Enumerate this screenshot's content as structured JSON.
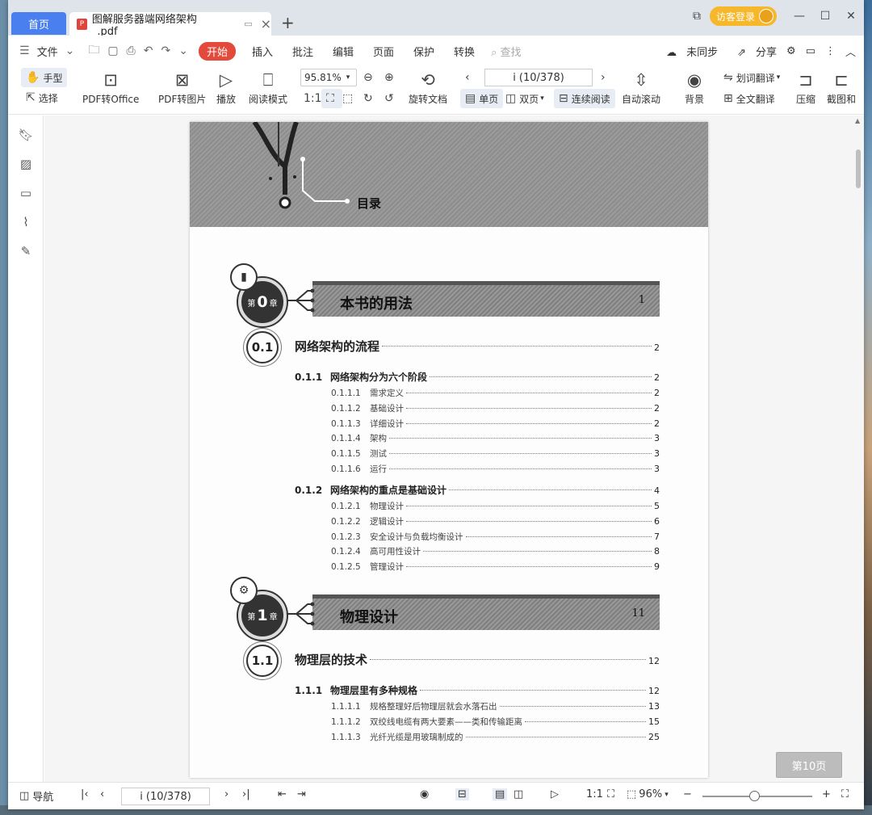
{
  "tabs": {
    "home": "首页",
    "doc_title": "图解服务器端网络架构_.pdf",
    "new_tab": "+"
  },
  "window": {
    "visitor": "访客登录",
    "minimize": "—",
    "maximize": "☐",
    "close": "✕",
    "panel": "⧉"
  },
  "menu": {
    "file": "文件",
    "items": [
      "开始",
      "插入",
      "批注",
      "编辑",
      "页面",
      "保护",
      "转换"
    ],
    "search_placeholder": "查找",
    "unsynced": "未同步",
    "share": "分享"
  },
  "ribbon": {
    "hand": "手型",
    "select": "选择",
    "pdf_to_office": "PDF转Office",
    "pdf_to_image": "PDF转图片",
    "play": "播放",
    "read_mode": "阅读模式",
    "zoom": "95.81%",
    "rotate_doc": "旋转文档",
    "page_indicator": "i (10/378)",
    "single_page": "单页",
    "double_page": "双页",
    "continuous": "连续阅读",
    "auto_scroll": "自动滚动",
    "background": "背景",
    "word_translate": "划词翻译",
    "full_translate": "全文翻译",
    "compress": "压缩",
    "screenshot": "截图和"
  },
  "document": {
    "header_title": "目录",
    "chapters": [
      {
        "label_pre": "第",
        "label_num": "0",
        "label_post": "章",
        "title": "本书的用法",
        "page": "1",
        "sections": [
          {
            "num": "0.1",
            "title": "网络架构的流程",
            "page": "2"
          }
        ],
        "entries": [
          {
            "level": 2,
            "num": "0.1.1",
            "title": "网络架构分为六个阶段",
            "page": "2"
          },
          {
            "level": 3,
            "num": "0.1.1.1",
            "title": "需求定义",
            "page": "2"
          },
          {
            "level": 3,
            "num": "0.1.1.2",
            "title": "基础设计",
            "page": "2"
          },
          {
            "level": 3,
            "num": "0.1.1.3",
            "title": "详细设计",
            "page": "2"
          },
          {
            "level": 3,
            "num": "0.1.1.4",
            "title": "架构",
            "page": "3"
          },
          {
            "level": 3,
            "num": "0.1.1.5",
            "title": "测试",
            "page": "3"
          },
          {
            "level": 3,
            "num": "0.1.1.6",
            "title": "运行",
            "page": "3"
          },
          {
            "level": 2,
            "num": "0.1.2",
            "title": "网络架构的重点是基础设计",
            "page": "4"
          },
          {
            "level": 3,
            "num": "0.1.2.1",
            "title": "物理设计",
            "page": "5"
          },
          {
            "level": 3,
            "num": "0.1.2.2",
            "title": "逻辑设计",
            "page": "6"
          },
          {
            "level": 3,
            "num": "0.1.2.3",
            "title": "安全设计与负载均衡设计",
            "page": "7"
          },
          {
            "level": 3,
            "num": "0.1.2.4",
            "title": "高可用性设计",
            "page": "8"
          },
          {
            "level": 3,
            "num": "0.1.2.5",
            "title": "管理设计",
            "page": "9"
          }
        ]
      },
      {
        "label_pre": "第",
        "label_num": "1",
        "label_post": "章",
        "title": "物理设计",
        "page": "11",
        "sections": [
          {
            "num": "1.1",
            "title": "物理层的技术",
            "page": "12"
          }
        ],
        "entries": [
          {
            "level": 2,
            "num": "1.1.1",
            "title": "物理层里有多种规格",
            "page": "12"
          },
          {
            "level": 3,
            "num": "1.1.1.1",
            "title": "规格整理好后物理层就会水落石出",
            "page": "13"
          },
          {
            "level": 3,
            "num": "1.1.1.2",
            "title": "双绞线电缆有两大要素——类和传输距离",
            "page": "15"
          },
          {
            "level": 3,
            "num": "1.1.1.3",
            "title": "光纤光缆是用玻璃制成的",
            "page": "25"
          }
        ]
      }
    ]
  },
  "page_badge": "第10页",
  "status": {
    "nav": "导航",
    "page_indicator": "i (10/378)",
    "zoom": "96%"
  }
}
